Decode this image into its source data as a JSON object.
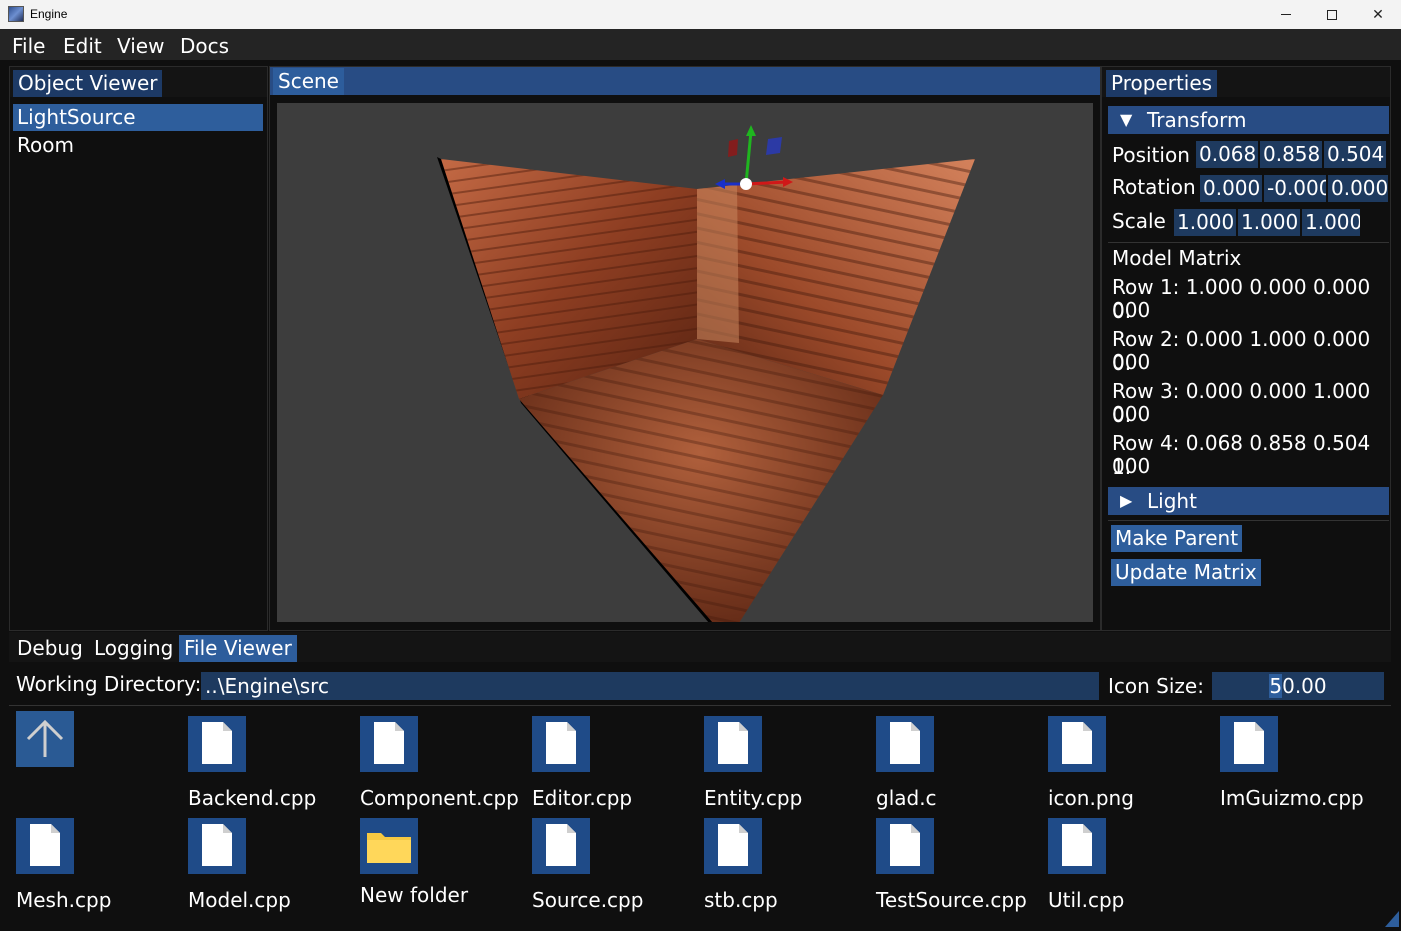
{
  "window": {
    "title": "Engine"
  },
  "menu": [
    "File",
    "Edit",
    "View",
    "Docs"
  ],
  "object_viewer": {
    "tab": "Object Viewer",
    "items": [
      {
        "label": "LightSource",
        "selected": true
      },
      {
        "label": "Room",
        "selected": false
      }
    ]
  },
  "scene": {
    "tab": "Scene"
  },
  "properties": {
    "tab": "Properties",
    "transform": {
      "header": "Transform",
      "position_label": "Position",
      "position": [
        "0.068",
        "0.858",
        "0.504"
      ],
      "rotation_label": "Rotation",
      "rotation": [
        "0.000",
        "-0.000",
        "0.000"
      ],
      "scale_label": "Scale",
      "scale": [
        "1.000",
        "1.000",
        "1.000"
      ]
    },
    "model_matrix": {
      "title": "Model Matrix",
      "rows": [
        {
          "line1": "Row 1: 1.000 0.000 0.000 0.",
          "line2": "000"
        },
        {
          "line1": "Row 2: 0.000 1.000 0.000 0.",
          "line2": "000"
        },
        {
          "line1": "Row 3: 0.000 0.000 1.000 0.",
          "line2": "000"
        },
        {
          "line1": "Row 4: 0.068 0.858 0.504 1.",
          "line2": "000"
        }
      ]
    },
    "light": {
      "header": "Light"
    },
    "buttons": {
      "make_parent": "Make Parent",
      "update_matrix": "Update Matrix"
    }
  },
  "bottom": {
    "tabs": [
      "Debug",
      "Logging",
      "File Viewer"
    ],
    "active_tab": "File Viewer",
    "working_directory_label": "Working Directory:",
    "working_directory": "..\\Engine\\src",
    "icon_size_label": "Icon Size:",
    "icon_size_cursor": "5",
    "icon_size_rest": "0.00",
    "files": [
      {
        "name": "Backend.cpp",
        "type": "file"
      },
      {
        "name": "Component.cpp",
        "type": "file"
      },
      {
        "name": "Editor.cpp",
        "type": "file"
      },
      {
        "name": "Entity.cpp",
        "type": "file"
      },
      {
        "name": "glad.c",
        "type": "file"
      },
      {
        "name": "icon.png",
        "type": "file"
      },
      {
        "name": "ImGuizmo.cpp",
        "type": "file"
      },
      {
        "name": "Mesh.cpp",
        "type": "file"
      },
      {
        "name": "Model.cpp",
        "type": "file"
      },
      {
        "name": "New folder",
        "type": "folder"
      },
      {
        "name": "Source.cpp",
        "type": "file"
      },
      {
        "name": "stb.cpp",
        "type": "file"
      },
      {
        "name": "TestSource.cpp",
        "type": "file"
      },
      {
        "name": "Util.cpp",
        "type": "file"
      }
    ]
  },
  "colors": {
    "accent": "#2e5e9c",
    "header": "#284c84",
    "field": "#1e3a5f",
    "room_texture": "#8a3d22"
  }
}
